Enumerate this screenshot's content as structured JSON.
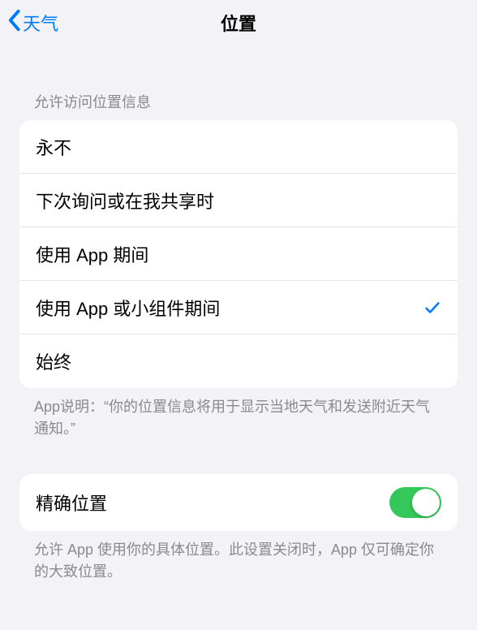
{
  "nav": {
    "back_label": "天气",
    "title": "位置"
  },
  "allow_access": {
    "header": "允许访问位置信息",
    "options": [
      {
        "label": "永不",
        "selected": false
      },
      {
        "label": "下次询问或在我共享时",
        "selected": false
      },
      {
        "label": "使用 App 期间",
        "selected": false
      },
      {
        "label": "使用 App 或小组件期间",
        "selected": true
      },
      {
        "label": "始终",
        "selected": false
      }
    ],
    "footer": "App说明：“你的位置信息将用于显示当地天气和发送附近天气通知。”"
  },
  "precise": {
    "label": "精确位置",
    "enabled": true,
    "footer": "允许 App 使用你的具体位置。此设置关闭时，App 仅可确定你的大致位置。"
  }
}
